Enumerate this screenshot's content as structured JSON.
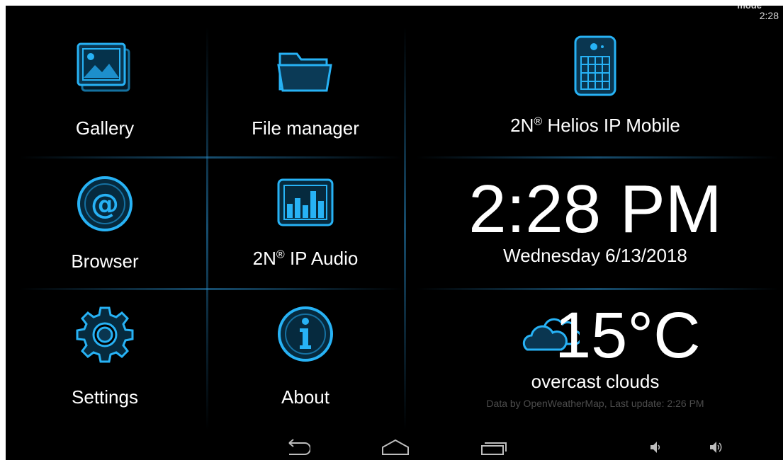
{
  "status_bar": {
    "mode_text": "mode",
    "clock": "2:28"
  },
  "tiles": {
    "gallery": {
      "label": "Gallery",
      "icon": "gallery-icon"
    },
    "file_manager": {
      "label": "File manager",
      "icon": "folder-icon"
    },
    "helios": {
      "label": "2N",
      "sup": "®",
      "label_rest": " Helios IP Mobile",
      "icon": "intercom-icon"
    },
    "browser": {
      "label": "Browser",
      "icon": "at-icon"
    },
    "ip_audio": {
      "label": "2N",
      "sup": "®",
      "label_rest": " IP Audio",
      "icon": "equalizer-icon"
    },
    "settings": {
      "label": "Settings",
      "icon": "gear-icon"
    },
    "about": {
      "label": "About",
      "icon": "info-icon"
    }
  },
  "clock_widget": {
    "time": "2:28 PM",
    "date": "Wednesday 6/13/2018"
  },
  "weather_widget": {
    "temperature": "15°C",
    "description": "overcast clouds",
    "credit": "Data by OpenWeatherMap, Last update: 2:26 PM",
    "icon": "cloud-icon"
  },
  "nav_bar": {
    "buttons": [
      "back-icon",
      "home-icon",
      "recents-icon",
      "volume-down-icon",
      "volume-up-icon"
    ]
  },
  "colors": {
    "accent": "#1fa3e6",
    "background": "#000000",
    "text": "#ffffff",
    "credit_text": "#4c4c4c"
  }
}
